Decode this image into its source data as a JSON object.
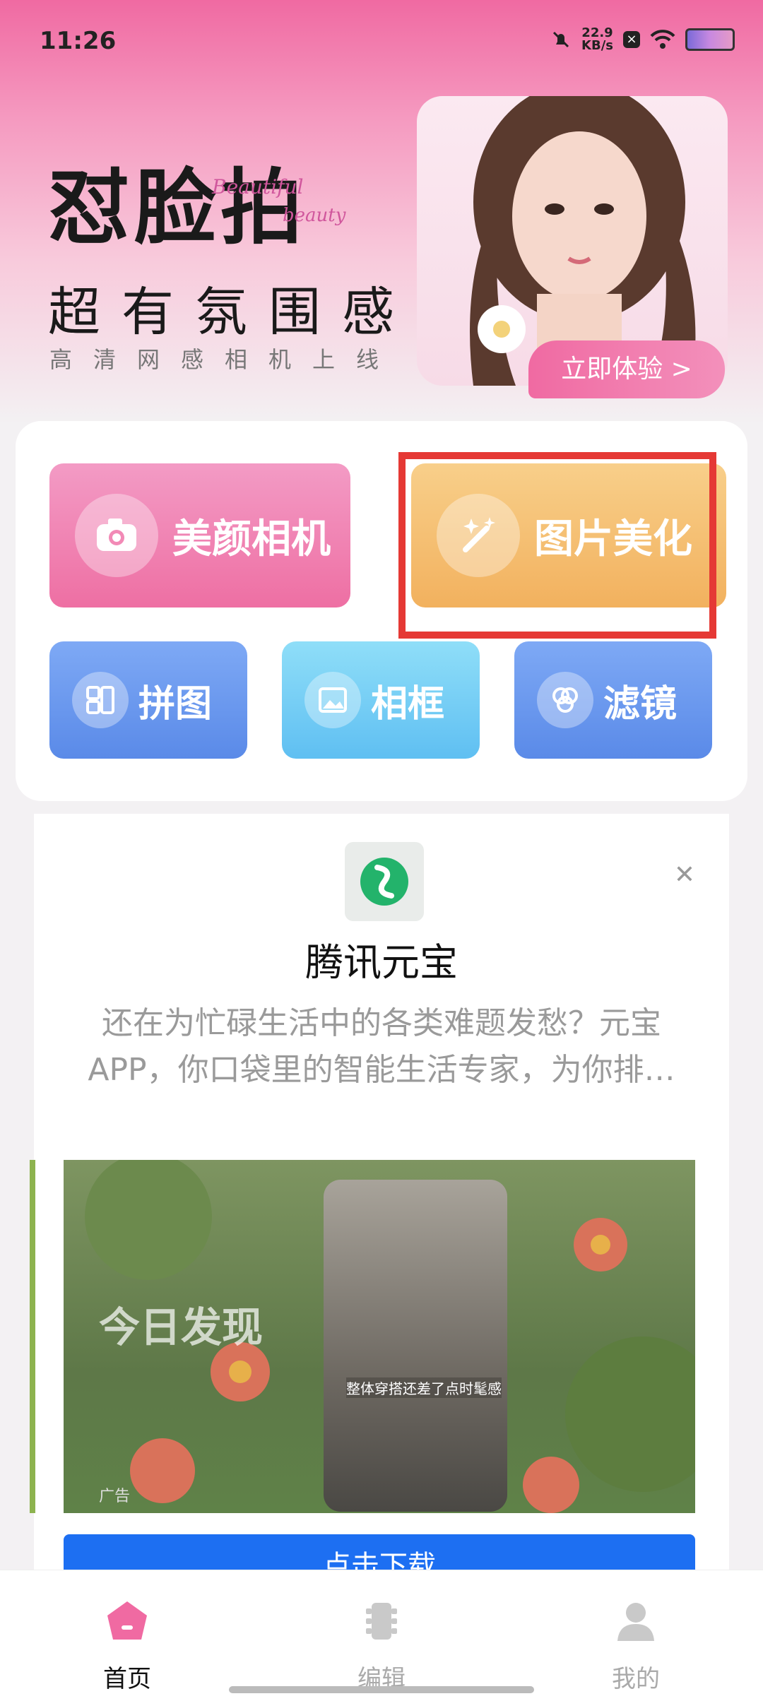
{
  "status_bar": {
    "time": "11:26",
    "net_speed_value": "22.9",
    "net_speed_unit": "KB/s"
  },
  "hero": {
    "title": "怼脸拍",
    "script_text_1": "Beautiful",
    "script_text_2": "beauty",
    "subtitle": "超有氛围感",
    "tagline": "高清网感相机上线",
    "cta_label": "立即体验 >"
  },
  "features": {
    "big": [
      {
        "label": "美颜相机",
        "icon": "camera-icon"
      },
      {
        "label": "图片美化",
        "icon": "magic-wand-icon"
      }
    ],
    "small": [
      {
        "label": "拼图",
        "icon": "collage-icon"
      },
      {
        "label": "相框",
        "icon": "frame-icon"
      },
      {
        "label": "滤镜",
        "icon": "filter-icon"
      }
    ]
  },
  "ad": {
    "app_name": "腾讯元宝",
    "description": "还在为忙碌生活中的各类难题发愁？元宝 APP，你口袋里的智能生活专家，为你排…",
    "video_overlay_text": "今日发现",
    "video_caption": "整体穿搭还差了点时髦感",
    "ad_tag": "广告",
    "download_label": "点击下载"
  },
  "bottom_nav": [
    {
      "label": "首页",
      "icon": "home-icon",
      "active": true
    },
    {
      "label": "编辑",
      "icon": "edit-icon",
      "active": false
    },
    {
      "label": "我的",
      "icon": "profile-icon",
      "active": false
    }
  ],
  "colors": {
    "accent_pink": "#f06aa2",
    "orange": "#f2b15e",
    "blue": "#5a8ae8",
    "highlight_red": "#e53935",
    "ad_button_blue": "#1d6ff2"
  }
}
